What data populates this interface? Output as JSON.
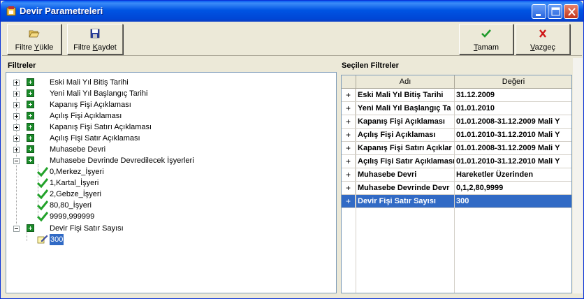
{
  "window": {
    "title": "Devir Parametreleri",
    "accent": "#0054e3"
  },
  "toolbar": {
    "load_filter": {
      "label_u": "Filtre ",
      "label_ul": "Y",
      "label_rest": "ükle",
      "icon": "open-folder-icon"
    },
    "save_filter": {
      "label_u": "Filtre ",
      "label_ul": "K",
      "label_rest": "aydet",
      "icon": "floppy-disk-icon"
    },
    "ok": {
      "label_ul": "T",
      "label_rest": "amam",
      "icon": "green-check-icon"
    },
    "cancel": {
      "label_ul": "V",
      "label_rest": "azgeç",
      "icon": "red-x-icon"
    }
  },
  "filters_panel": {
    "heading": "Filtreler",
    "items": [
      "Eski Mali Yıl Bitiş Tarihi",
      "Yeni Mali Yıl Başlangıç Tarihi",
      "Kapanış Fişi Açıklaması",
      "Açılış Fişi Açıklaması",
      "Kapanış Fişi Satırı Açıklaması",
      "Açılış Fişi Satır Açıklaması",
      "Muhasebe Devri",
      "Muhasebe Devrinde Devredilecek İşyerleri"
    ],
    "workplaces": [
      "0,Merkez_İşyeri",
      "1,Kartal_İşyeri",
      "2,Gebze_İşyeri",
      "80,80_İşyeri",
      "9999,999999"
    ],
    "last_item": "Devir Fişi Satır Sayısı",
    "last_item_value": "300"
  },
  "selected_panel": {
    "heading": "Seçilen Filtreler",
    "columns": [
      "Adı",
      "Değeri"
    ],
    "rows": [
      {
        "name": "Eski Mali Yıl Bitiş Tarihi",
        "value": "31.12.2009"
      },
      {
        "name": "Yeni Mali Yıl Başlangıç Ta",
        "value": "01.01.2010"
      },
      {
        "name": "Kapanış Fişi Açıklaması",
        "value": "01.01.2008-31.12.2009 Mali Y"
      },
      {
        "name": "Açılış Fişi Açıklaması",
        "value": "01.01.2010-31.12.2010 Mali Y"
      },
      {
        "name": "Kapanış Fişi Satırı Açıklar",
        "value": "01.01.2008-31.12.2009 Mali Y"
      },
      {
        "name": "Açılış Fişi Satır Açıklaması",
        "value": "01.01.2010-31.12.2010 Mali Y"
      },
      {
        "name": "Muhasebe Devri",
        "value": "Hareketler Üzerinden"
      },
      {
        "name": "Muhasebe Devrinde Devr",
        "value": "0,1,2,80,9999"
      },
      {
        "name": "Devir Fişi Satır Sayısı",
        "value": "300"
      }
    ],
    "row_marker": "+"
  }
}
